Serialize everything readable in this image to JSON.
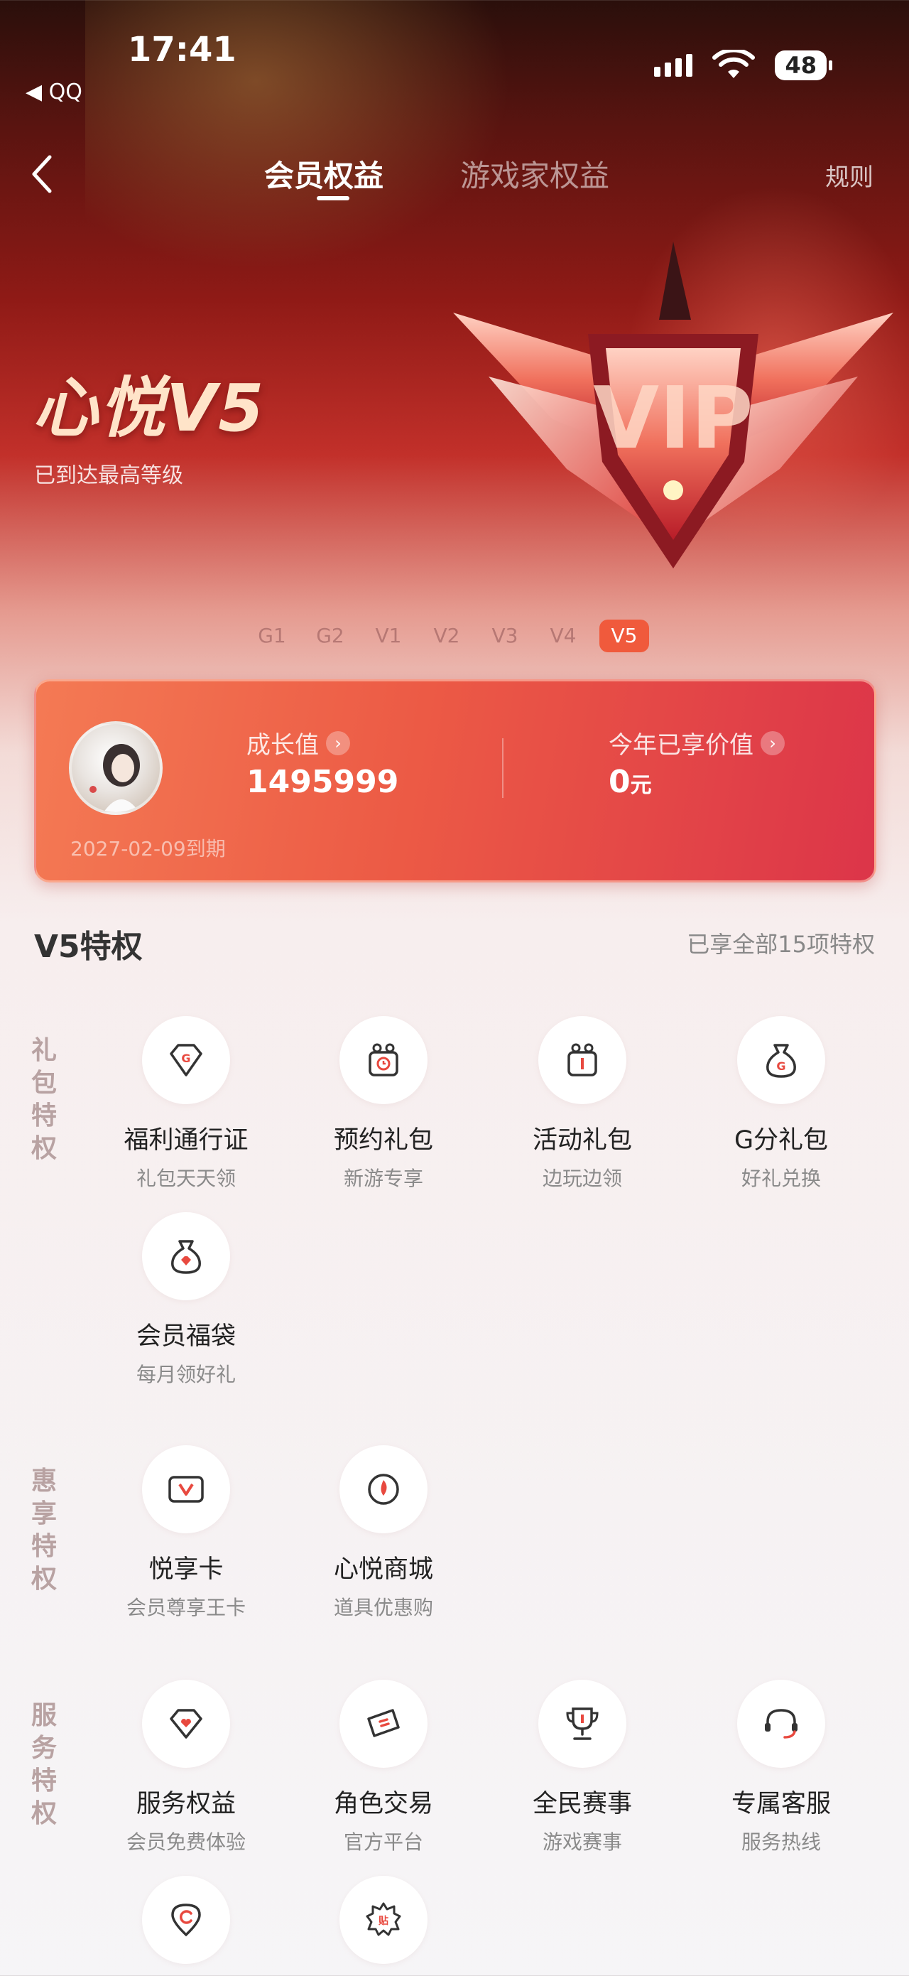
{
  "status": {
    "time": "17:41",
    "back_app": "◀ QQ",
    "battery": "48"
  },
  "nav": {
    "tabs": [
      "会员权益",
      "游戏家权益"
    ],
    "rules": "规则"
  },
  "hero": {
    "level_name": "心悦V5",
    "level_sub": "已到达最高等级",
    "levels": [
      "G1",
      "G2",
      "V1",
      "V2",
      "V3",
      "V4",
      "V5"
    ],
    "active_level": "V5"
  },
  "card": {
    "growth_label": "成长值",
    "growth_value": "1495999",
    "value_label": "今年已享价值",
    "value_amount": "0",
    "value_unit": "元",
    "expiry": "2027-02-09到期"
  },
  "privileges": {
    "title": "V5特权",
    "note": "已享全部15项特权",
    "groups": [
      {
        "label": "礼包特权",
        "items": [
          {
            "name": "福利通行证",
            "desc": "礼包天天领",
            "icon": "diamond-g-icon"
          },
          {
            "name": "预约礼包",
            "desc": "新游专享",
            "icon": "gift-clock-icon"
          },
          {
            "name": "活动礼包",
            "desc": "边玩边领",
            "icon": "gift-box-icon"
          },
          {
            "name": "G分礼包",
            "desc": "好礼兑换",
            "icon": "money-bag-g-icon"
          },
          {
            "name": "会员福袋",
            "desc": "每月领好礼",
            "icon": "lucky-bag-icon"
          }
        ]
      },
      {
        "label": "惠享特权",
        "items": [
          {
            "name": "悦享卡",
            "desc": "会员尊享王卡",
            "icon": "card-v-icon"
          },
          {
            "name": "心悦商城",
            "desc": "道具优惠购",
            "icon": "store-icon"
          }
        ]
      },
      {
        "label": "服务特权",
        "items": [
          {
            "name": "服务权益",
            "desc": "会员免费体验",
            "icon": "diamond-heart-icon"
          },
          {
            "name": "角色交易",
            "desc": "官方平台",
            "icon": "ticket-icon"
          },
          {
            "name": "全民赛事",
            "desc": "游戏赛事",
            "icon": "trophy-icon"
          },
          {
            "name": "专属客服",
            "desc": "服务热线",
            "icon": "headset-icon"
          },
          {
            "name": "",
            "desc": "",
            "icon": "location-pin-icon"
          },
          {
            "name": "",
            "desc": "",
            "icon": "badge-tie-icon"
          }
        ]
      }
    ]
  },
  "colors": {
    "accent": "#e8493f",
    "card_start": "#f47a54",
    "card_end": "#dc3549"
  }
}
